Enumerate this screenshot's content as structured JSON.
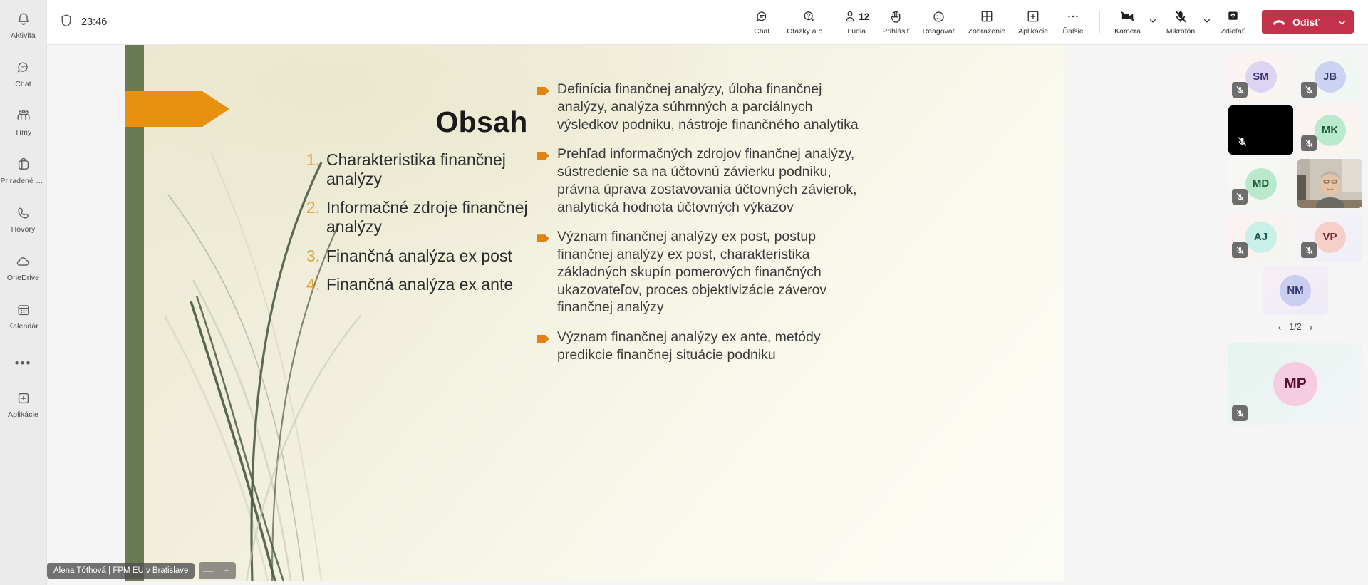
{
  "rail": {
    "items": [
      {
        "label": "Aktivita",
        "icon": "bell-icon"
      },
      {
        "label": "Chat",
        "icon": "chat-icon"
      },
      {
        "label": "Tímy",
        "icon": "teams-icon"
      },
      {
        "label": "Priradené ú…",
        "icon": "assignments-icon"
      },
      {
        "label": "Hovory",
        "icon": "calls-icon"
      },
      {
        "label": "OneDrive",
        "icon": "cloud-icon"
      },
      {
        "label": "Kalendár",
        "icon": "calendar-icon"
      }
    ],
    "more_label": "•••",
    "apps": {
      "label": "Aplikácie",
      "icon": "plus-square-icon"
    }
  },
  "topbar": {
    "shield_icon": "shield-icon",
    "timer": "23:46",
    "buttons": [
      {
        "label": "Chat",
        "icon": "chat-bubble-icon",
        "count": ""
      },
      {
        "label": "Otázky a od…",
        "icon": "qna-icon",
        "count": ""
      },
      {
        "label": "Ľudia",
        "icon": "people-icon",
        "count": "12"
      },
      {
        "label": "Prihlásiť",
        "icon": "raise-hand-icon",
        "count": ""
      },
      {
        "label": "Reagovať",
        "icon": "emoji-icon",
        "count": ""
      },
      {
        "label": "Zobrazenie",
        "icon": "view-grid-icon",
        "count": ""
      },
      {
        "label": "Aplikácie",
        "icon": "apps-plus-icon",
        "count": ""
      },
      {
        "label": "Ďalšie",
        "icon": "more-ellipsis-icon",
        "count": ""
      }
    ],
    "devices": [
      {
        "label": "Kamera",
        "icon": "camera-off-icon",
        "has_chevron": true
      },
      {
        "label": "Mikrofón",
        "icon": "mic-off-icon",
        "has_chevron": true
      },
      {
        "label": "Zdieľať",
        "icon": "share-up-icon",
        "has_chevron": false
      }
    ],
    "leave": {
      "label": "Odísť",
      "icon": "hangup-icon",
      "color": "#c4314b"
    }
  },
  "slide": {
    "title": "Obsah",
    "accent_orange": "#e8900f",
    "accent_green": "#697a55",
    "numbered": [
      {
        "num": "1.",
        "text": "Charakteristika finančnej analýzy"
      },
      {
        "num": "2.",
        "text": "Informačné zdroje finančnej analýzy"
      },
      {
        "num": "3.",
        "text": "Finančná analýza ex post"
      },
      {
        "num": "4.",
        "text": "Finančná analýza ex ante"
      }
    ],
    "bullets": [
      "Definícia finančnej analýzy, úloha finančnej analýzy, analýza súhrnných a parciálnych výsledkov podniku, nástroje finančného analytika",
      "Prehľad informačných zdrojov finančnej analýzy, sústredenie sa na účtovnú závierku podniku, právna úprava zostavovania účtovných závierok, analytická hodnota účtovných výkazov",
      "Význam finančnej analýzy ex post, postup finančnej analýzy ex post, charakteristika základných skupín pomerových finančných ukazovateľov, proces objektivizácie záverov finančnej analýzy",
      "Význam finančnej analýzy ex ante, metódy predikcie finančnej situácie podniku"
    ]
  },
  "presenter": {
    "name": "Alena Tóthová | FPM EU v Bratislave",
    "zoom_out": "—",
    "zoom_in": "+"
  },
  "roster": {
    "tiles": [
      {
        "initials": "SM",
        "muted": true,
        "video": false,
        "speaking": false,
        "av_bg": "#dcd5f2",
        "av_fg": "#3c3273",
        "bg": "linear-gradient(135deg,#fdf2f4 0%,#f7f6ef 100%)"
      },
      {
        "initials": "JB",
        "muted": true,
        "video": false,
        "speaking": false,
        "av_bg": "#ccd2f2",
        "av_fg": "#2f3a70",
        "bg": "linear-gradient(135deg,#f6f6f2 0%,#eef7f2 100%)"
      },
      {
        "initials": "",
        "muted": true,
        "video": true,
        "speaking": false,
        "av_bg": "",
        "av_fg": "",
        "bg": "#000000"
      },
      {
        "initials": "MK",
        "muted": true,
        "video": false,
        "speaking": false,
        "av_bg": "#b9eacd",
        "av_fg": "#1d5c38",
        "bg": "linear-gradient(135deg,#fdf1f3 0%,#f6f5ef 100%)"
      },
      {
        "initials": "MD",
        "muted": true,
        "video": false,
        "speaking": false,
        "av_bg": "#b9e9cc",
        "av_fg": "#1d5c38",
        "bg": "linear-gradient(135deg,#f8f7f3 0%,#f3f6f2 100%)"
      },
      {
        "initials": "",
        "muted": false,
        "video": true,
        "speaking": true,
        "av_bg": "",
        "av_fg": "",
        "bg": "#cfc8bd"
      },
      {
        "initials": "AJ",
        "muted": true,
        "video": false,
        "speaking": false,
        "av_bg": "#c8efe8",
        "av_fg": "#1b5a55",
        "bg": "linear-gradient(135deg,#fdf2f3 0%,#f4f4ee 100%)"
      },
      {
        "initials": "VP",
        "muted": true,
        "video": false,
        "speaking": false,
        "av_bg": "#f7cfc9",
        "av_fg": "#7d2a30",
        "bg": "linear-gradient(135deg,#f7f3f6 0%,#efeef8 100%)"
      }
    ],
    "last_tile": {
      "initials": "NM",
      "muted": false,
      "av_bg": "#c9cdef",
      "av_fg": "#2f3a70",
      "bg": "linear-gradient(135deg,#f7eef5 0%,#eeecf7 100%)"
    },
    "pager": {
      "prev": "‹",
      "current": "1/2",
      "next": "›"
    },
    "spotlight": {
      "initials": "MP",
      "muted": true,
      "av_bg": "#f6cce0",
      "av_fg": "#5e1033",
      "bg": "linear-gradient(135deg,#e5f4ee 0%,#f3f5f7 100%)"
    }
  }
}
